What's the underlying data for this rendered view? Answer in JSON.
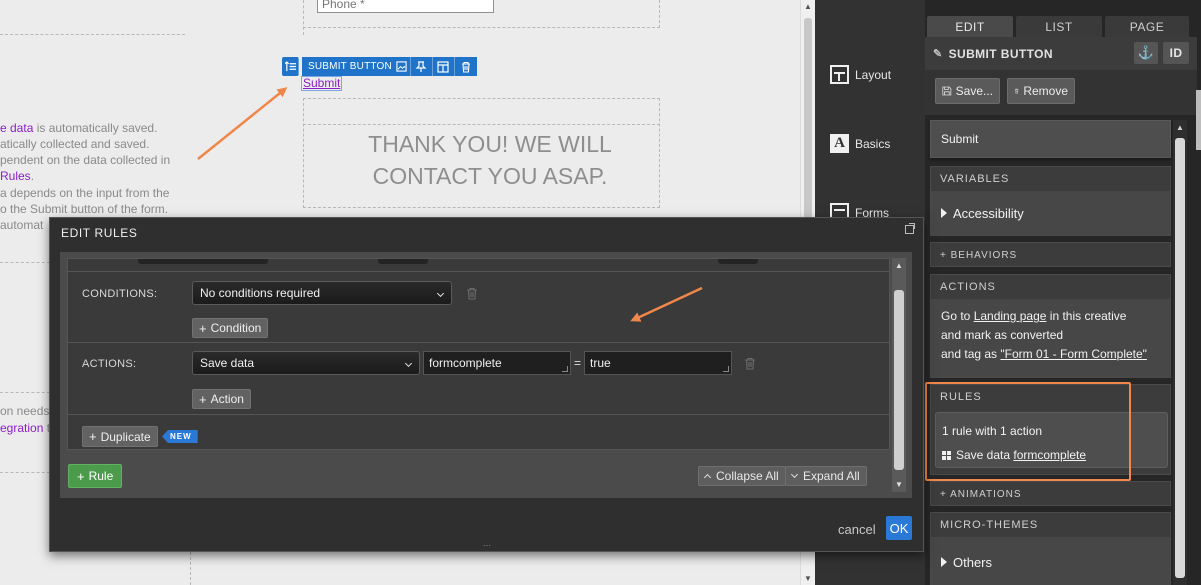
{
  "canvas": {
    "phone_placeholder": "Phone *",
    "element_toolbar": {
      "label": "SUBMIT BUTTON"
    },
    "submit_link": "Submit",
    "thank_you_line1": "THANK YOU! WE WILL",
    "thank_you_line2": "CONTACT YOU ASAP.",
    "text_lines": [
      {
        "purple": "e data",
        "rest": " is automatically saved."
      },
      {
        "purple": "",
        "rest": "atically collected and saved."
      },
      {
        "purple": "",
        "rest": "pendent on the data collected in"
      },
      {
        "purple": "Rules",
        "rest": "."
      },
      {
        "purple": "",
        "rest": "a depends on the input from the"
      },
      {
        "purple": "",
        "rest": "o the Submit button of the form."
      },
      {
        "purple": "",
        "rest": "automat"
      }
    ],
    "lower_lines": [
      {
        "purple": "",
        "rest": "on needs"
      },
      {
        "purple": "egration",
        "rest": " t"
      }
    ]
  },
  "nav": {
    "items": [
      {
        "label": "Layout",
        "icon": "layout-icon"
      },
      {
        "label": "Basics",
        "icon": "text-a-icon"
      },
      {
        "label": "Forms",
        "icon": "forms-icon"
      }
    ]
  },
  "panel": {
    "tabs": [
      "EDIT",
      "LIST",
      "PAGE"
    ],
    "header_title": "SUBMIT BUTTON",
    "id_label": "ID",
    "save_label": "Save...",
    "remove_label": "Remove",
    "submit_value": "Submit",
    "variables": {
      "title": "VARIABLES",
      "item": "Accessibility"
    },
    "behaviors_title": "+ BEHAVIORS",
    "actions": {
      "title": "ACTIONS",
      "line1_prefix": "Go to ",
      "line1_link": "Landing page",
      "line1_suffix": " in this creative",
      "line2": "and mark as converted",
      "line3_prefix": "and tag as ",
      "line3_link": "\"Form 01 - Form Complete\""
    },
    "rules": {
      "title": "RULES",
      "summary": "1 rule with 1 action",
      "detail_prefix": "Save data ",
      "detail_link": "formcomplete"
    },
    "animations_title": "+ ANIMATIONS",
    "micro_themes": {
      "title": "MICRO-THEMES",
      "item": "Others"
    }
  },
  "modal": {
    "title": "EDIT RULES",
    "conditions_label": "CONDITIONS:",
    "conditions_value": "No conditions required",
    "add_condition": "Condition",
    "actions_label": "ACTIONS:",
    "action_type": "Save data",
    "action_key": "formcomplete",
    "equals": "=",
    "action_value": "true",
    "add_action": "Action",
    "duplicate_label": "Duplicate",
    "new_badge": "NEW",
    "add_rule": "Rule",
    "collapse_all": "Collapse All",
    "expand_all": "Expand All",
    "cancel": "cancel",
    "ok": "OK"
  },
  "colors": {
    "accent_blue": "#1f73c9",
    "annotation_orange": "#f0874a",
    "link_purple": "#8b1ec7",
    "rule_green": "#4c9a4c"
  }
}
